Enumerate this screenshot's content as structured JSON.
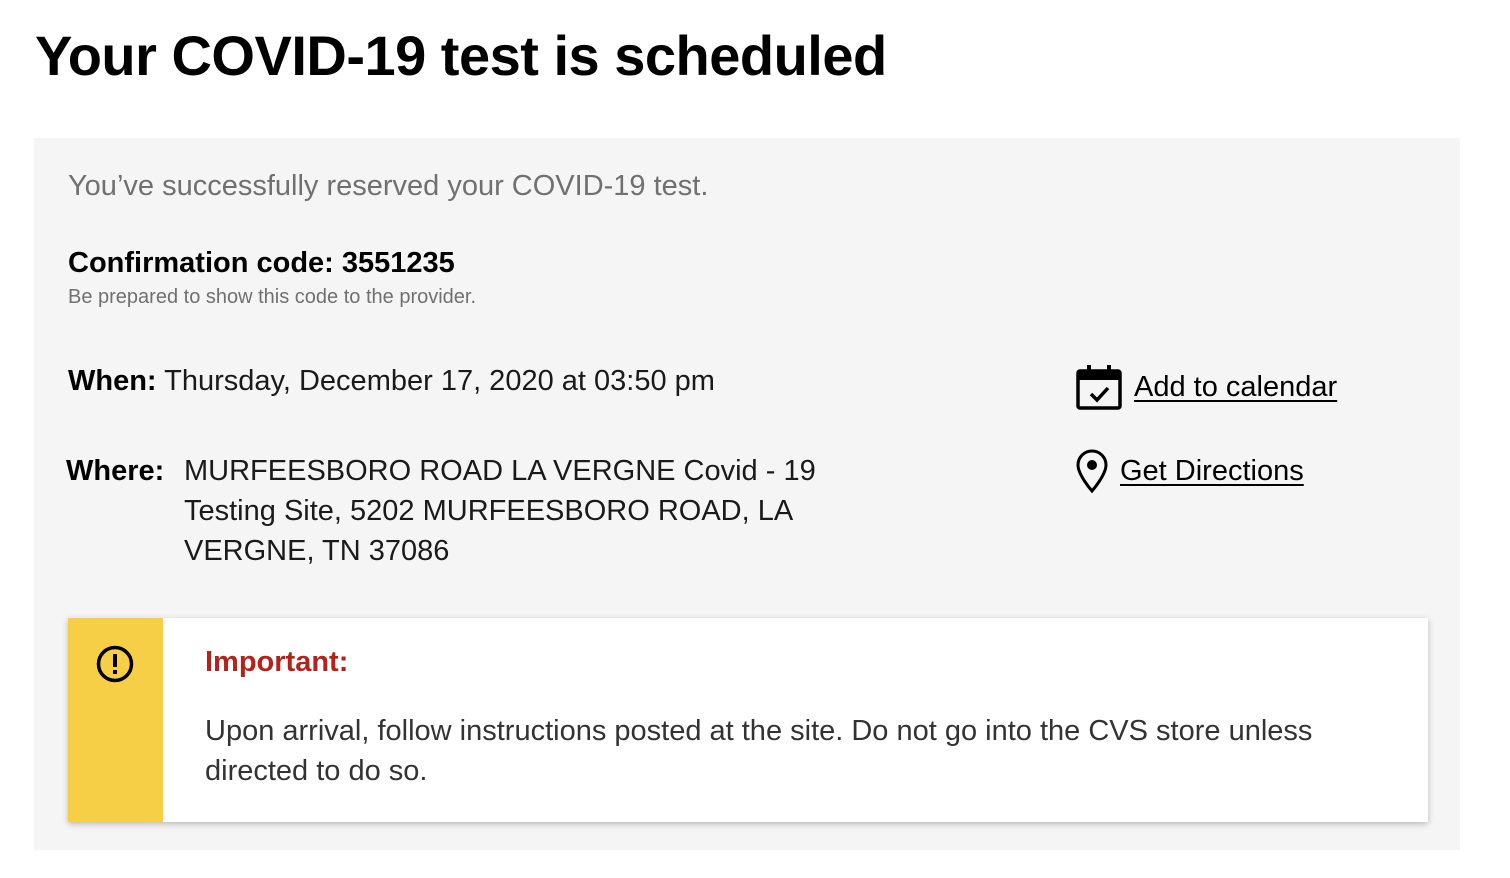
{
  "page": {
    "title": "Your COVID-19 test is scheduled"
  },
  "confirmation": {
    "intro": "You’ve successfully reserved your COVID-19 test.",
    "code_text": "Confirmation code: 3551235",
    "note": "Be prepared to show this code to the provider."
  },
  "appointment": {
    "when_label": "When:",
    "when_value": "Thursday, December 17, 2020 at 03:50 pm",
    "where_label": "Where:",
    "where_value": "MURFEESBORO ROAD LA VERGNE Covid - 19 Testing Site, 5202 MURFEESBORO ROAD, LA VERGNE, TN 37086"
  },
  "actions": {
    "calendar_label": "Add to calendar",
    "calendar_icon": "calendar-check-icon",
    "directions_label": "Get Directions",
    "directions_icon": "map-pin-icon"
  },
  "alert": {
    "icon": "exclamation-circle-icon",
    "title": "Important:",
    "text": "Upon arrival, follow instructions posted at the site. Do not go into the CVS store unless directed to do so."
  },
  "colors": {
    "panel_background": "#f5f5f5",
    "alert_stripe": "#f6cf47",
    "alert_title": "#b4231b",
    "muted_text": "#707070"
  }
}
